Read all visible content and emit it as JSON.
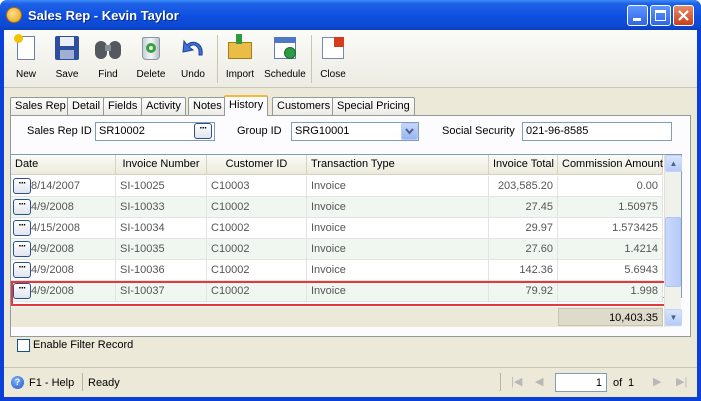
{
  "window": {
    "title": "Sales Rep - Kevin  Taylor"
  },
  "toolbar": {
    "new": "New",
    "save": "Save",
    "find": "Find",
    "delete": "Delete",
    "undo": "Undo",
    "import": "Import",
    "schedule": "Schedule",
    "close": "Close"
  },
  "tabs": [
    "Sales Rep",
    "Detail",
    "Fields",
    "Activity",
    "Notes",
    "History",
    "Customers",
    "Special Pricing"
  ],
  "form": {
    "sales_rep_id_label": "Sales Rep ID",
    "sales_rep_id": "SR10002",
    "group_id_label": "Group ID",
    "group_id": "SRG10001",
    "social_security_label": "Social Security",
    "social_security": "021-96-8585"
  },
  "grid": {
    "columns": [
      "Date",
      "Invoice Number",
      "Customer ID",
      "Transaction Type",
      "Invoice Total",
      "Commission Amount"
    ],
    "rows": [
      {
        "date": "8/14/2007",
        "invoice": "SI-10025",
        "customer": "C10003",
        "type": "Invoice",
        "total": "203,585.20",
        "commission": "0.00"
      },
      {
        "date": "4/9/2008",
        "invoice": "SI-10033",
        "customer": "C10002",
        "type": "Invoice",
        "total": "27.45",
        "commission": "1.50975"
      },
      {
        "date": "4/15/2008",
        "invoice": "SI-10034",
        "customer": "C10002",
        "type": "Invoice",
        "total": "29.97",
        "commission": "1.573425"
      },
      {
        "date": "4/9/2008",
        "invoice": "SI-10035",
        "customer": "C10002",
        "type": "Invoice",
        "total": "27.60",
        "commission": "1.4214"
      },
      {
        "date": "4/9/2008",
        "invoice": "SI-10036",
        "customer": "C10002",
        "type": "Invoice",
        "total": "142.36",
        "commission": "5.6943"
      },
      {
        "date": "4/9/2008",
        "invoice": "SI-10037",
        "customer": "C10002",
        "type": "Invoice",
        "total": "79.92",
        "commission": "1.998"
      }
    ],
    "commission_total": "10,403.35"
  },
  "filter": {
    "label": "Enable Filter Record"
  },
  "status": {
    "help": "F1 - Help",
    "state": "Ready",
    "page": "1",
    "of_label": "of",
    "page_count": "1"
  }
}
